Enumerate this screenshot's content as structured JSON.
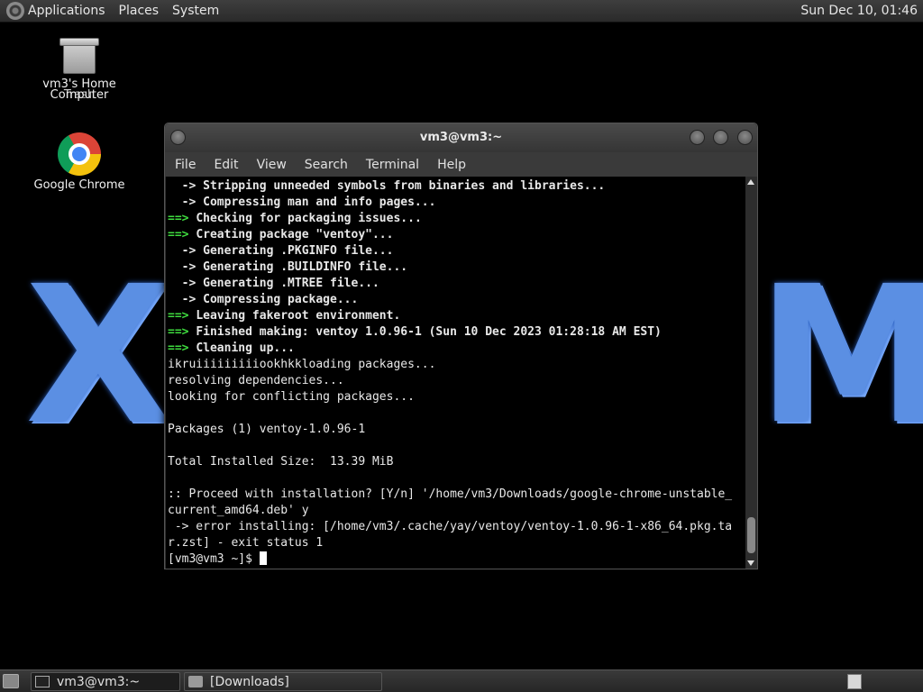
{
  "top_panel": {
    "menus": [
      "Applications",
      "Places",
      "System"
    ],
    "clock": "Sun Dec 10, 01:46"
  },
  "desktop": {
    "icons": [
      {
        "label": "vm3's Home",
        "overlap_label": "Trash",
        "icon": "trash-icon"
      },
      {
        "label": "Computer"
      },
      {
        "label": "Google Chrome",
        "icon": "chrome-icon"
      }
    ],
    "wallpaper_letters": [
      "X",
      "M"
    ]
  },
  "terminal": {
    "title": "vm3@vm3:~",
    "menu": [
      "File",
      "Edit",
      "View",
      "Search",
      "Terminal",
      "Help"
    ],
    "lines": [
      {
        "prefix": "  -> ",
        "text": "Stripping unneeded symbols from binaries and libraries...",
        "style": "sub"
      },
      {
        "prefix": "  -> ",
        "text": "Compressing man and info pages...",
        "style": "sub"
      },
      {
        "prefix": "==> ",
        "text": "Checking for packaging issues...",
        "style": "main"
      },
      {
        "prefix": "==> ",
        "text": "Creating package \"ventoy\"...",
        "style": "main"
      },
      {
        "prefix": "  -> ",
        "text": "Generating .PKGINFO file...",
        "style": "sub"
      },
      {
        "prefix": "  -> ",
        "text": "Generating .BUILDINFO file...",
        "style": "sub"
      },
      {
        "prefix": "  -> ",
        "text": "Generating .MTREE file...",
        "style": "sub"
      },
      {
        "prefix": "  -> ",
        "text": "Compressing package...",
        "style": "sub"
      },
      {
        "prefix": "==> ",
        "text": "Leaving fakeroot environment.",
        "style": "main"
      },
      {
        "prefix": "==> ",
        "text": "Finished making: ventoy 1.0.96-1 (Sun 10 Dec 2023 01:28:18 AM EST)",
        "style": "main"
      },
      {
        "prefix": "==> ",
        "text": "Cleaning up...",
        "style": "main"
      },
      {
        "prefix": "",
        "text": "ikruiiiiiiiiiookhkkloading packages...",
        "style": "plain"
      },
      {
        "prefix": "",
        "text": "resolving dependencies...",
        "style": "plain"
      },
      {
        "prefix": "",
        "text": "looking for conflicting packages...",
        "style": "plain"
      },
      {
        "prefix": "",
        "text": "",
        "style": "plain"
      },
      {
        "prefix": "",
        "text": "Packages (1) ventoy-1.0.96-1",
        "style": "plain"
      },
      {
        "prefix": "",
        "text": "",
        "style": "plain"
      },
      {
        "prefix": "",
        "text": "Total Installed Size:  13.39 MiB",
        "style": "plain"
      },
      {
        "prefix": "",
        "text": "",
        "style": "plain"
      },
      {
        "prefix": "",
        "text": ":: Proceed with installation? [Y/n] '/home/vm3/Downloads/google-chrome-unstable_",
        "style": "plain"
      },
      {
        "prefix": "",
        "text": "current_amd64.deb' y",
        "style": "plain"
      },
      {
        "prefix": "",
        "text": " -> error installing: [/home/vm3/.cache/yay/ventoy/ventoy-1.0.96-1-x86_64.pkg.ta",
        "style": "plain"
      },
      {
        "prefix": "",
        "text": "r.zst] - exit status 1",
        "style": "plain"
      }
    ],
    "prompt": "[vm3@vm3 ~]$ "
  },
  "bottom_panel": {
    "tasks": [
      {
        "label": "vm3@vm3:~",
        "icon": "terminal-icon",
        "active": true
      },
      {
        "label": "[Downloads]",
        "icon": "folder-icon",
        "active": false
      }
    ]
  }
}
